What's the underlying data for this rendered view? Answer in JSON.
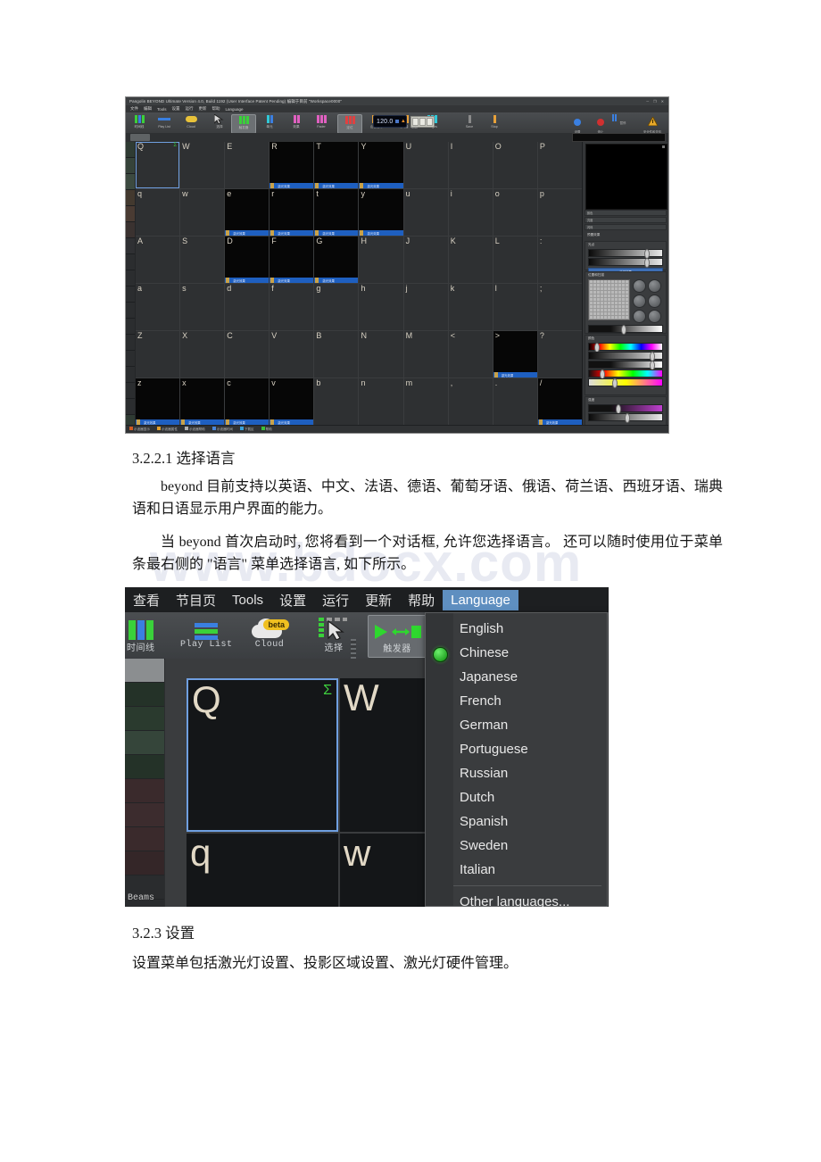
{
  "document": {
    "watermark": "www.bdocx.com",
    "sections": [
      {
        "id": "h1",
        "heading": "3.2.2.1 选择语言"
      },
      {
        "id": "h2",
        "heading": "3.2.3 设置"
      }
    ],
    "paragraphs": {
      "p1": "beyond 目前支持以英语、中文、法语、德语、葡萄牙语、俄语、荷兰语、西班牙语、瑞典语和日语显示用户界面的能力。",
      "p2": "当 beyond 首次启动时, 您将看到一个对话框, 允许您选择语言。 还可以随时使用位于菜单条最右侧的 \"语言\" 菜单选择语言, 如下所示。",
      "p3": "设置菜单包括激光灯设置、投影区域设置、激光灯硬件管理。"
    }
  },
  "screenshot_main": {
    "titlebar": {
      "text": "Pangolin BEYOND Ultimate   Version 4.0, Build 1192   (User Interface Patent Pending)   编辑于目前 \"Workspace0000\"",
      "window_controls": "─ ❐ ✕"
    },
    "menubar": [
      "文件",
      "编辑",
      "Tools",
      "设置",
      "运行",
      "更新",
      "帮助",
      "Language"
    ],
    "toolbar": {
      "items": [
        {
          "label": "时间线",
          "icon": "bars-grid-icon",
          "selected": false
        },
        {
          "label": "Play List",
          "icon": "bars-horizontal-icon",
          "selected": false
        },
        {
          "label": "Cloud",
          "icon": "cloud-beta-icon",
          "selected": false
        },
        {
          "label": "选择",
          "icon": "cursor-select-icon",
          "selected": false
        },
        {
          "label": "触发器",
          "icon": "trigger-icon",
          "selected": true
        },
        {
          "label": "单元",
          "icon": "cell-icon",
          "selected": false
        },
        {
          "label": "效果",
          "icon": "effect-icon",
          "selected": false
        },
        {
          "label": "Fader",
          "icon": "fader-icon",
          "selected": false
        },
        {
          "label": "定位",
          "icon": "locate-icon",
          "selected": true
        },
        {
          "label": "山谷音乐",
          "icon": "music-icon",
          "selected": false
        },
        {
          "label": "时间轴",
          "icon": "timeline-icon",
          "selected": false
        },
        {
          "label": "Images",
          "icon": "images-icon",
          "selected": false
        },
        {
          "label": "Save",
          "icon": "save-icon",
          "selected": false
        },
        {
          "label": "Stop",
          "icon": "stop-icon",
          "selected": false
        }
      ],
      "bpm_value": "120.0",
      "bpm_unit": "BPM",
      "seg_display": "000",
      "seg_label": "MIDI",
      "right_items": [
        {
          "label": "设置",
          "icon": "settings-blue-icon"
        },
        {
          "label": "停止",
          "icon": "stop-red-icon"
        },
        {
          "label": "暂停",
          "icon": "pause-blue-icon"
        },
        {
          "label": "安全性和关机",
          "icon": "warning-triangle-icon"
        }
      ]
    },
    "grid": {
      "rows": [
        [
          "Q",
          "W",
          "E",
          "R",
          "T",
          "Y",
          "U",
          "I",
          "O",
          "P"
        ],
        [
          "q",
          "w",
          "e",
          "r",
          "t",
          "y",
          "u",
          "i",
          "o",
          "p"
        ],
        [
          "A",
          "S",
          "D",
          "F",
          "G",
          "H",
          "J",
          "K",
          "L",
          ":"
        ],
        [
          "a",
          "s",
          "d",
          "f",
          "g",
          "h",
          "j",
          "k",
          "l",
          ";"
        ],
        [
          "Z",
          "X",
          "C",
          "V",
          "B",
          "N",
          "M",
          "<",
          ">",
          "?"
        ],
        [
          "z",
          "x",
          "c",
          "v",
          "b",
          "n",
          "m",
          ",",
          ".",
          "/"
        ]
      ],
      "selected_cell": "Q",
      "cue_label": "激光效果"
    },
    "right_dock": {
      "sections": [
        "预置效果",
        "光点",
        "位置和扫描",
        "颜色",
        "强度"
      ],
      "buttons": [
        "重置位置",
        "重置尺寸"
      ],
      "apply_label": "应用效果",
      "labels": [
        "颜色",
        "亮度",
        "闪烁",
        "色彩映射"
      ]
    },
    "statusbar": [
      "示波器显示",
      "示波器属性",
      "示波器帮助",
      "示波器时间",
      "下载区",
      "帮助"
    ]
  },
  "screenshot_language_menu": {
    "menubar": [
      {
        "label": "查看",
        "active": false
      },
      {
        "label": "节目页",
        "active": false
      },
      {
        "label": "Tools",
        "active": false
      },
      {
        "label": "设置",
        "active": false
      },
      {
        "label": "运行",
        "active": false
      },
      {
        "label": "更新",
        "active": false
      },
      {
        "label": "帮助",
        "active": false
      },
      {
        "label": "Language",
        "active": true
      }
    ],
    "toolbar": [
      {
        "label": "时间线",
        "icon": "bars-grid-icon",
        "selected": false
      },
      {
        "label": "Play List",
        "icon": "bars-horizontal-icon",
        "selected": false
      },
      {
        "label": "Cloud",
        "icon": "cloud-beta-icon",
        "badge": "beta",
        "selected": false
      },
      {
        "label": "选择",
        "icon": "cursor-select-icon",
        "selected": false
      },
      {
        "label": "触发器",
        "icon": "trigger-icon",
        "selected": true
      }
    ],
    "dropdown": {
      "items": [
        {
          "label": "English",
          "checked": false
        },
        {
          "label": "Chinese",
          "checked": true
        },
        {
          "label": "Japanese",
          "checked": false
        },
        {
          "label": "French",
          "checked": false
        },
        {
          "label": "German",
          "checked": false
        },
        {
          "label": "Portuguese",
          "checked": false
        },
        {
          "label": "Russian",
          "checked": false
        },
        {
          "label": "Dutch",
          "checked": false
        },
        {
          "label": "Spanish",
          "checked": false
        },
        {
          "label": "Sweden",
          "checked": false
        },
        {
          "label": "Italian",
          "checked": false
        },
        {
          "label": "Other languages...",
          "checked": false
        }
      ],
      "selected": "Chinese",
      "accent_color": "#5f8fc0",
      "indicator_color": "#3fd13f"
    },
    "sidebar": {
      "bottom_label": "Beams"
    },
    "grid_cells": [
      "Q",
      "W",
      "q",
      "w"
    ],
    "selected_cell": "Q",
    "sigma_symbol": "Σ"
  }
}
